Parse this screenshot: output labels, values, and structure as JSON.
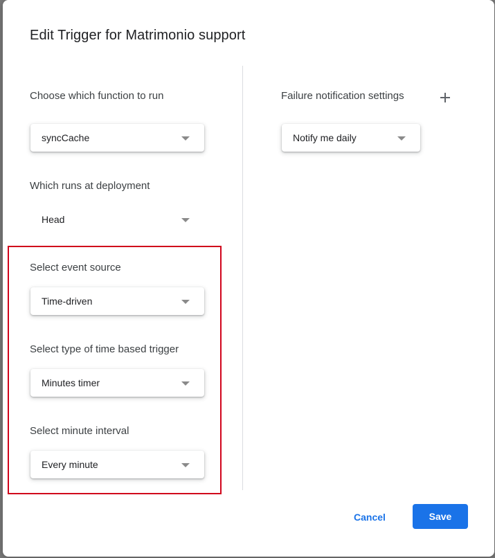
{
  "dialog": {
    "title": "Edit Trigger for Matrimonio support"
  },
  "left": {
    "function": {
      "label": "Choose which function to run",
      "value": "syncCache"
    },
    "deployment": {
      "label": "Which runs at deployment",
      "value": "Head"
    },
    "event_source": {
      "label": "Select event source",
      "value": "Time-driven"
    },
    "trigger_type": {
      "label": "Select type of time based trigger",
      "value": "Minutes timer"
    },
    "interval": {
      "label": "Select minute interval",
      "value": "Every minute"
    }
  },
  "right": {
    "failure": {
      "label": "Failure notification settings",
      "value": "Notify me daily",
      "add_icon": "plus-icon"
    }
  },
  "footer": {
    "cancel_label": "Cancel",
    "save_label": "Save"
  },
  "colors": {
    "accent": "#1a73e8",
    "highlight": "#d0021b"
  }
}
